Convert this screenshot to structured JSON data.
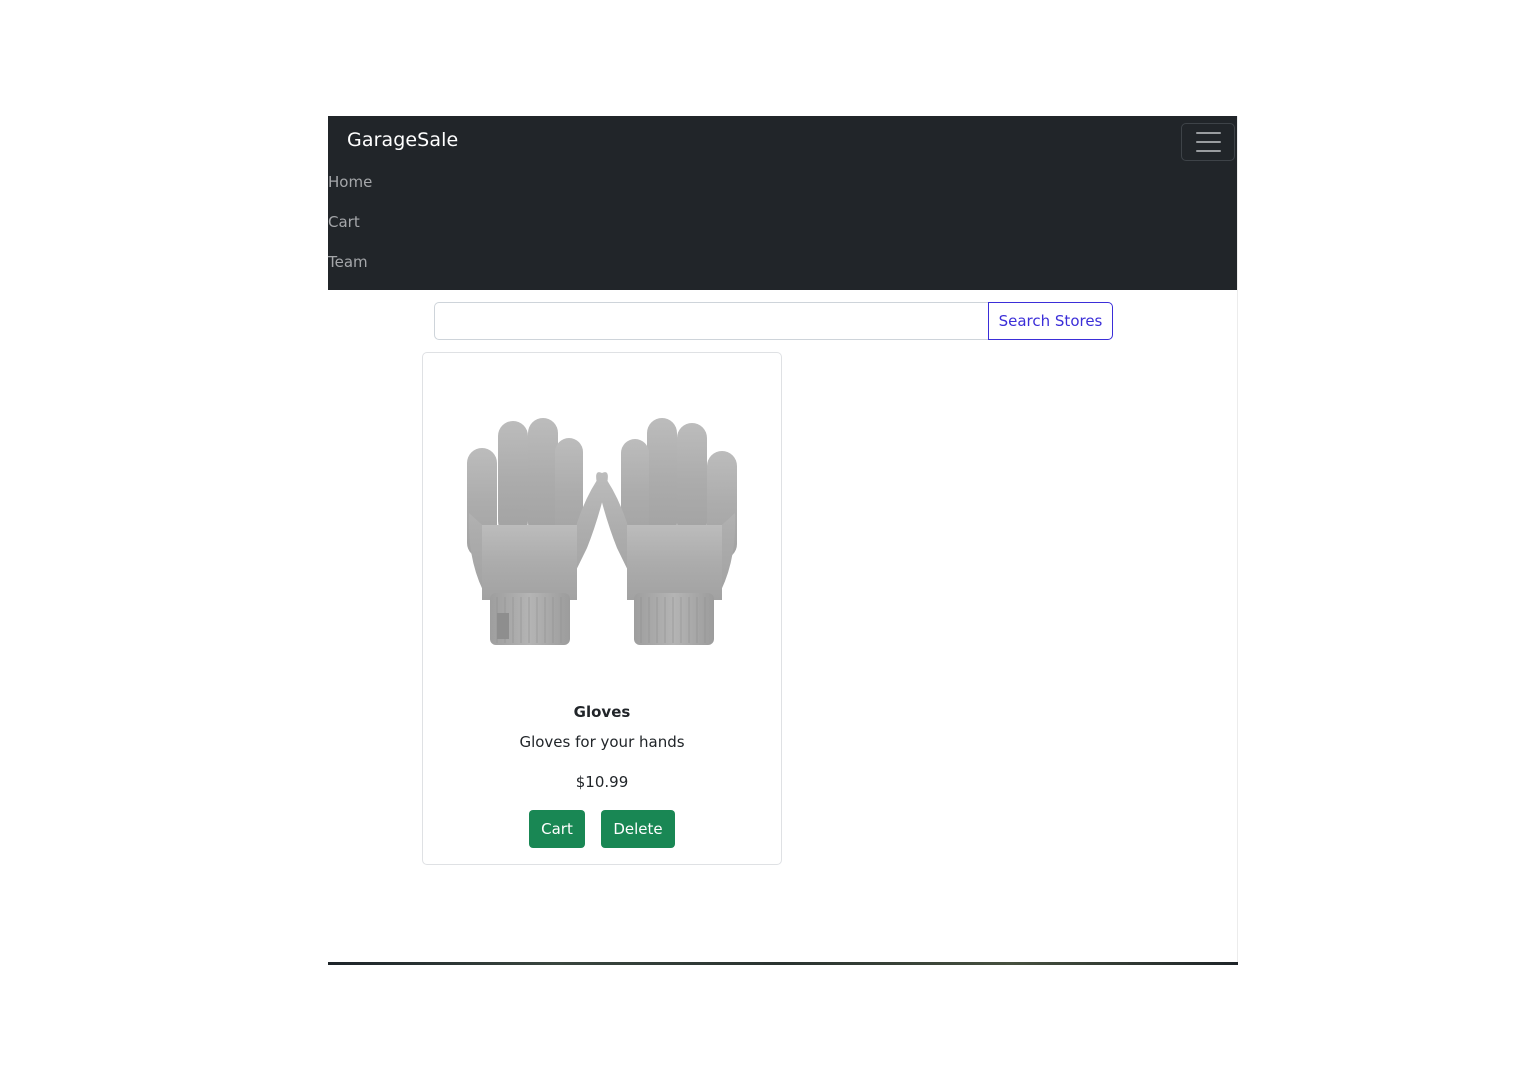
{
  "navbar": {
    "brand": "GarageSale",
    "toggler_icon": "hamburger-menu-icon",
    "links": [
      {
        "label": "Home"
      },
      {
        "label": "Cart"
      },
      {
        "label": "Team"
      }
    ]
  },
  "search": {
    "value": "",
    "button_label": "Search Stores",
    "button_color": "#3b2ed8"
  },
  "products": [
    {
      "image_icon": "gloves-image",
      "title": "Gloves",
      "description": "Gloves for your hands",
      "price": "$10.99",
      "cart_label": "Cart",
      "delete_label": "Delete"
    }
  ],
  "colors": {
    "navbar_bg": "#212529",
    "button_green": "#198754"
  }
}
